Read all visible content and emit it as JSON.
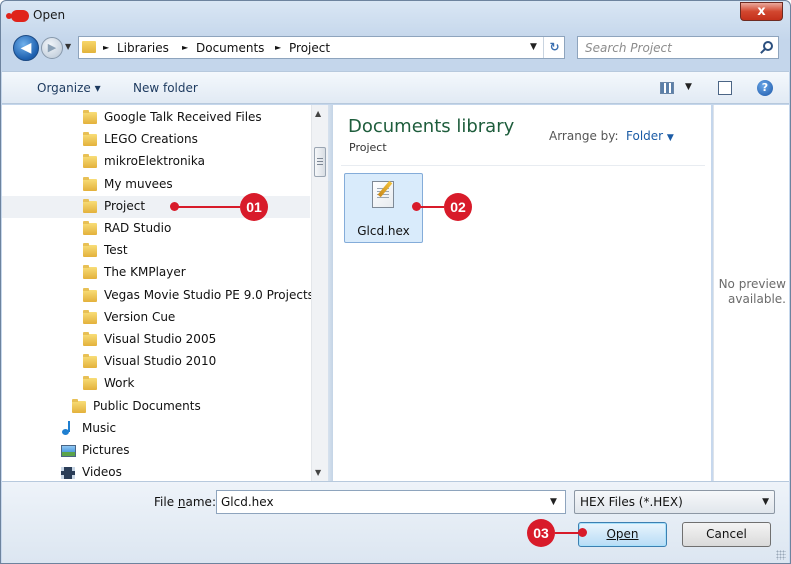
{
  "window": {
    "title": "Open",
    "close_label": "x"
  },
  "address": {
    "crumbs": [
      "Libraries",
      "Documents",
      "Project"
    ],
    "separator": "►",
    "search_placeholder": "Search Project"
  },
  "toolbar": {
    "organize_label": "Organize ▾",
    "new_folder_label": "New folder",
    "help_label": "?"
  },
  "nav": {
    "items": [
      {
        "label": "Google Talk Received Files",
        "icon": "folder-icon"
      },
      {
        "label": "LEGO Creations",
        "icon": "folder-icon"
      },
      {
        "label": "mikroElektronika",
        "icon": "folder-icon"
      },
      {
        "label": "My muvees",
        "icon": "folder-icon"
      },
      {
        "label": "Project",
        "icon": "folder-icon",
        "selected": true
      },
      {
        "label": "RAD Studio",
        "icon": "folder-icon"
      },
      {
        "label": "Test",
        "icon": "folder-icon"
      },
      {
        "label": "The KMPlayer",
        "icon": "folder-icon"
      },
      {
        "label": "Vegas Movie Studio PE 9.0 Projects",
        "icon": "folder-icon"
      },
      {
        "label": "Version Cue",
        "icon": "folder-icon"
      },
      {
        "label": "Visual Studio 2005",
        "icon": "folder-icon"
      },
      {
        "label": "Visual Studio 2010",
        "icon": "folder-icon"
      },
      {
        "label": "Work",
        "icon": "folder-icon"
      },
      {
        "label": "Public Documents",
        "icon": "folder-icon"
      },
      {
        "label": "Music",
        "icon": "music-icon"
      },
      {
        "label": "Pictures",
        "icon": "pictures-icon"
      },
      {
        "label": "Videos",
        "icon": "videos-icon"
      }
    ]
  },
  "content": {
    "title": "Documents library",
    "subtitle": "Project",
    "arrange_by_label": "Arrange by:",
    "arrange_by_value": "Folder",
    "files": [
      {
        "name": "Glcd.hex",
        "icon": "hex-file-icon"
      }
    ]
  },
  "preview": {
    "text": "No preview available."
  },
  "bottom": {
    "file_name_label": "File name:",
    "file_name_value": "Glcd.hex",
    "filter_value": "HEX Files (*.HEX)",
    "open_label": "Open",
    "cancel_label": "Cancel"
  },
  "callouts": [
    "01",
    "02",
    "03"
  ],
  "colors": {
    "callout": "#d81b2a",
    "library_title": "#1e5d3c",
    "link": "#1c5ca6"
  }
}
